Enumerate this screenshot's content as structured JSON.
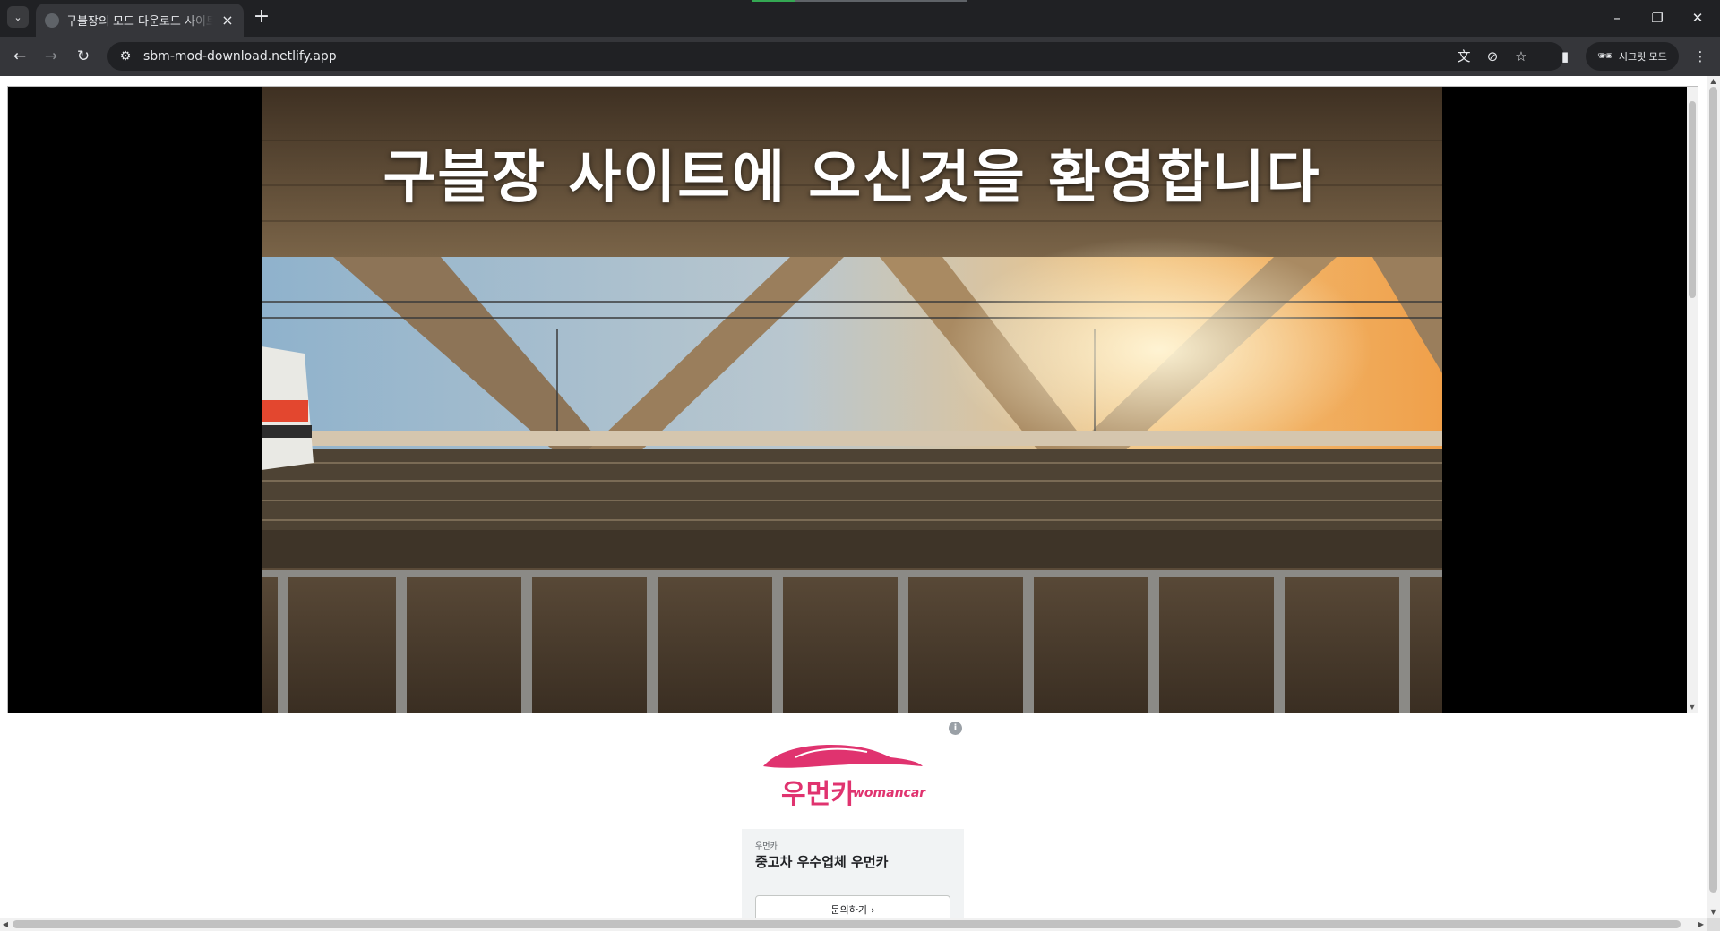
{
  "browser": {
    "tab_title": "구블장의 모드 다운로드 사이트",
    "url": "sbm-mod-download.netlify.app",
    "incognito_label": "시크릿 모드",
    "icons": {
      "tab_search": "chevron-down-icon",
      "new_tab": "plus-icon",
      "back": "arrow-left-icon",
      "forward": "arrow-right-icon",
      "reload": "reload-icon",
      "site_info": "tune-icon",
      "translate": "translate-icon",
      "tracking": "eye-off-icon",
      "bookmark": "star-icon",
      "side_panel": "side-panel-icon",
      "menu": "kebab-menu-icon"
    }
  },
  "page": {
    "hero_title": "구블장 사이트에 오신것을 환영합니다"
  },
  "ad": {
    "brand_ko": "우먼카",
    "brand_en": "womancar",
    "advertiser": "우먼카",
    "headline": "중고차 우수업체 우먼카",
    "cta_label": "문의하기",
    "brand_color": "#e0336f"
  }
}
